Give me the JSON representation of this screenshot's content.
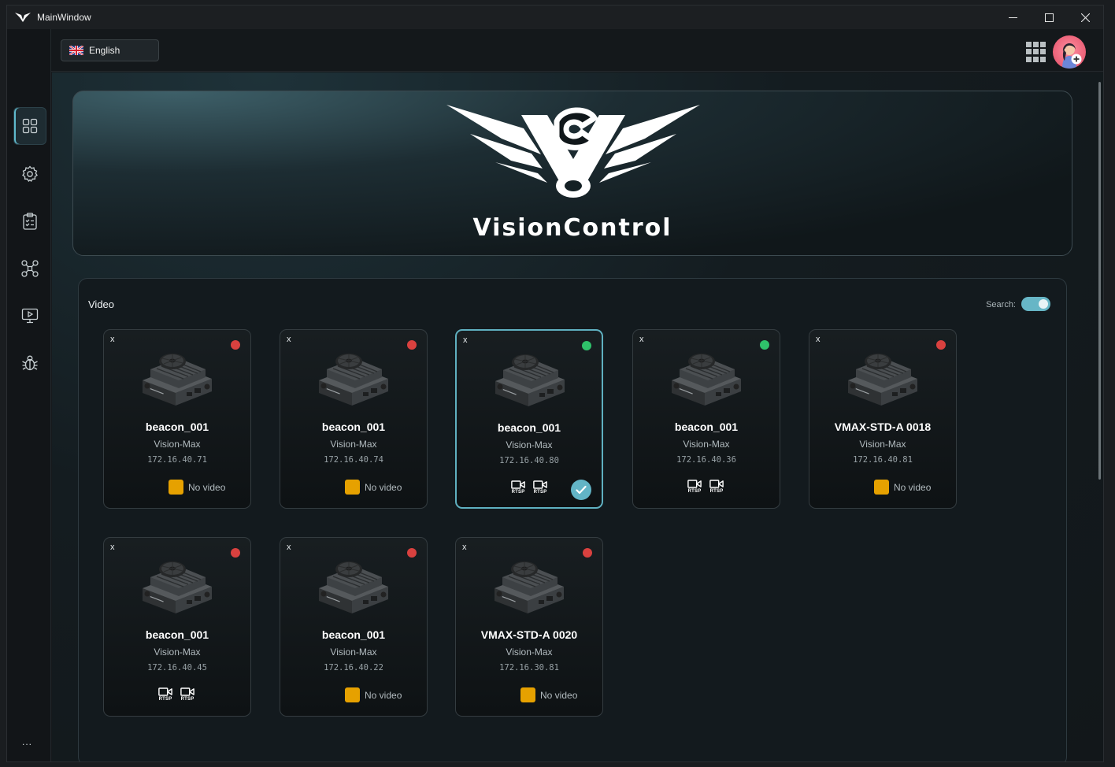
{
  "window": {
    "title": "MainWindow"
  },
  "topbar": {
    "language": "English"
  },
  "brand": {
    "name": "VisionControl"
  },
  "video": {
    "title": "Video",
    "search_label": "Search:",
    "search_enabled": true,
    "cards": [
      {
        "name": "beacon_001",
        "model": "Vision-Max",
        "ip": "172.16.40.71",
        "status": "red",
        "video": "none",
        "no_video_text": "No video"
      },
      {
        "name": "beacon_001",
        "model": "Vision-Max",
        "ip": "172.16.40.74",
        "status": "red",
        "video": "none",
        "no_video_text": "No video"
      },
      {
        "name": "beacon_001",
        "model": "Vision-Max",
        "ip": "172.16.40.80",
        "status": "green",
        "video": "rtsp",
        "rtsp_labels": [
          "RTSP",
          "RTSP"
        ],
        "selected": true
      },
      {
        "name": "beacon_001",
        "model": "Vision-Max",
        "ip": "172.16.40.36",
        "status": "green",
        "video": "rtsp",
        "rtsp_labels": [
          "RTSP",
          "RTSP"
        ]
      },
      {
        "name": "VMAX-STD-A 0018",
        "model": "Vision-Max",
        "ip": "172.16.40.81",
        "status": "red",
        "video": "none",
        "no_video_text": "No video"
      },
      {
        "name": "beacon_001",
        "model": "Vision-Max",
        "ip": "172.16.40.45",
        "status": "red",
        "video": "rtsp",
        "rtsp_labels": [
          "RTSP",
          "RTSP"
        ]
      },
      {
        "name": "beacon_001",
        "model": "Vision-Max",
        "ip": "172.16.40.22",
        "status": "red",
        "video": "none",
        "no_video_text": "No video"
      },
      {
        "name": "VMAX-STD-A 0020",
        "model": "Vision-Max",
        "ip": "172.16.30.81",
        "status": "red",
        "video": "none",
        "no_video_text": "No video"
      }
    ]
  },
  "colors": {
    "accent": "#62b4c6",
    "status_red": "#d9413f",
    "status_green": "#2fc16a",
    "no_video": "#e6a100"
  },
  "sidebar": {
    "icons": [
      "dashboard-icon",
      "settings-gear-icon",
      "clipboard-checklist-icon",
      "drone-icon",
      "monitor-play-icon",
      "bug-icon"
    ],
    "more": "..."
  }
}
